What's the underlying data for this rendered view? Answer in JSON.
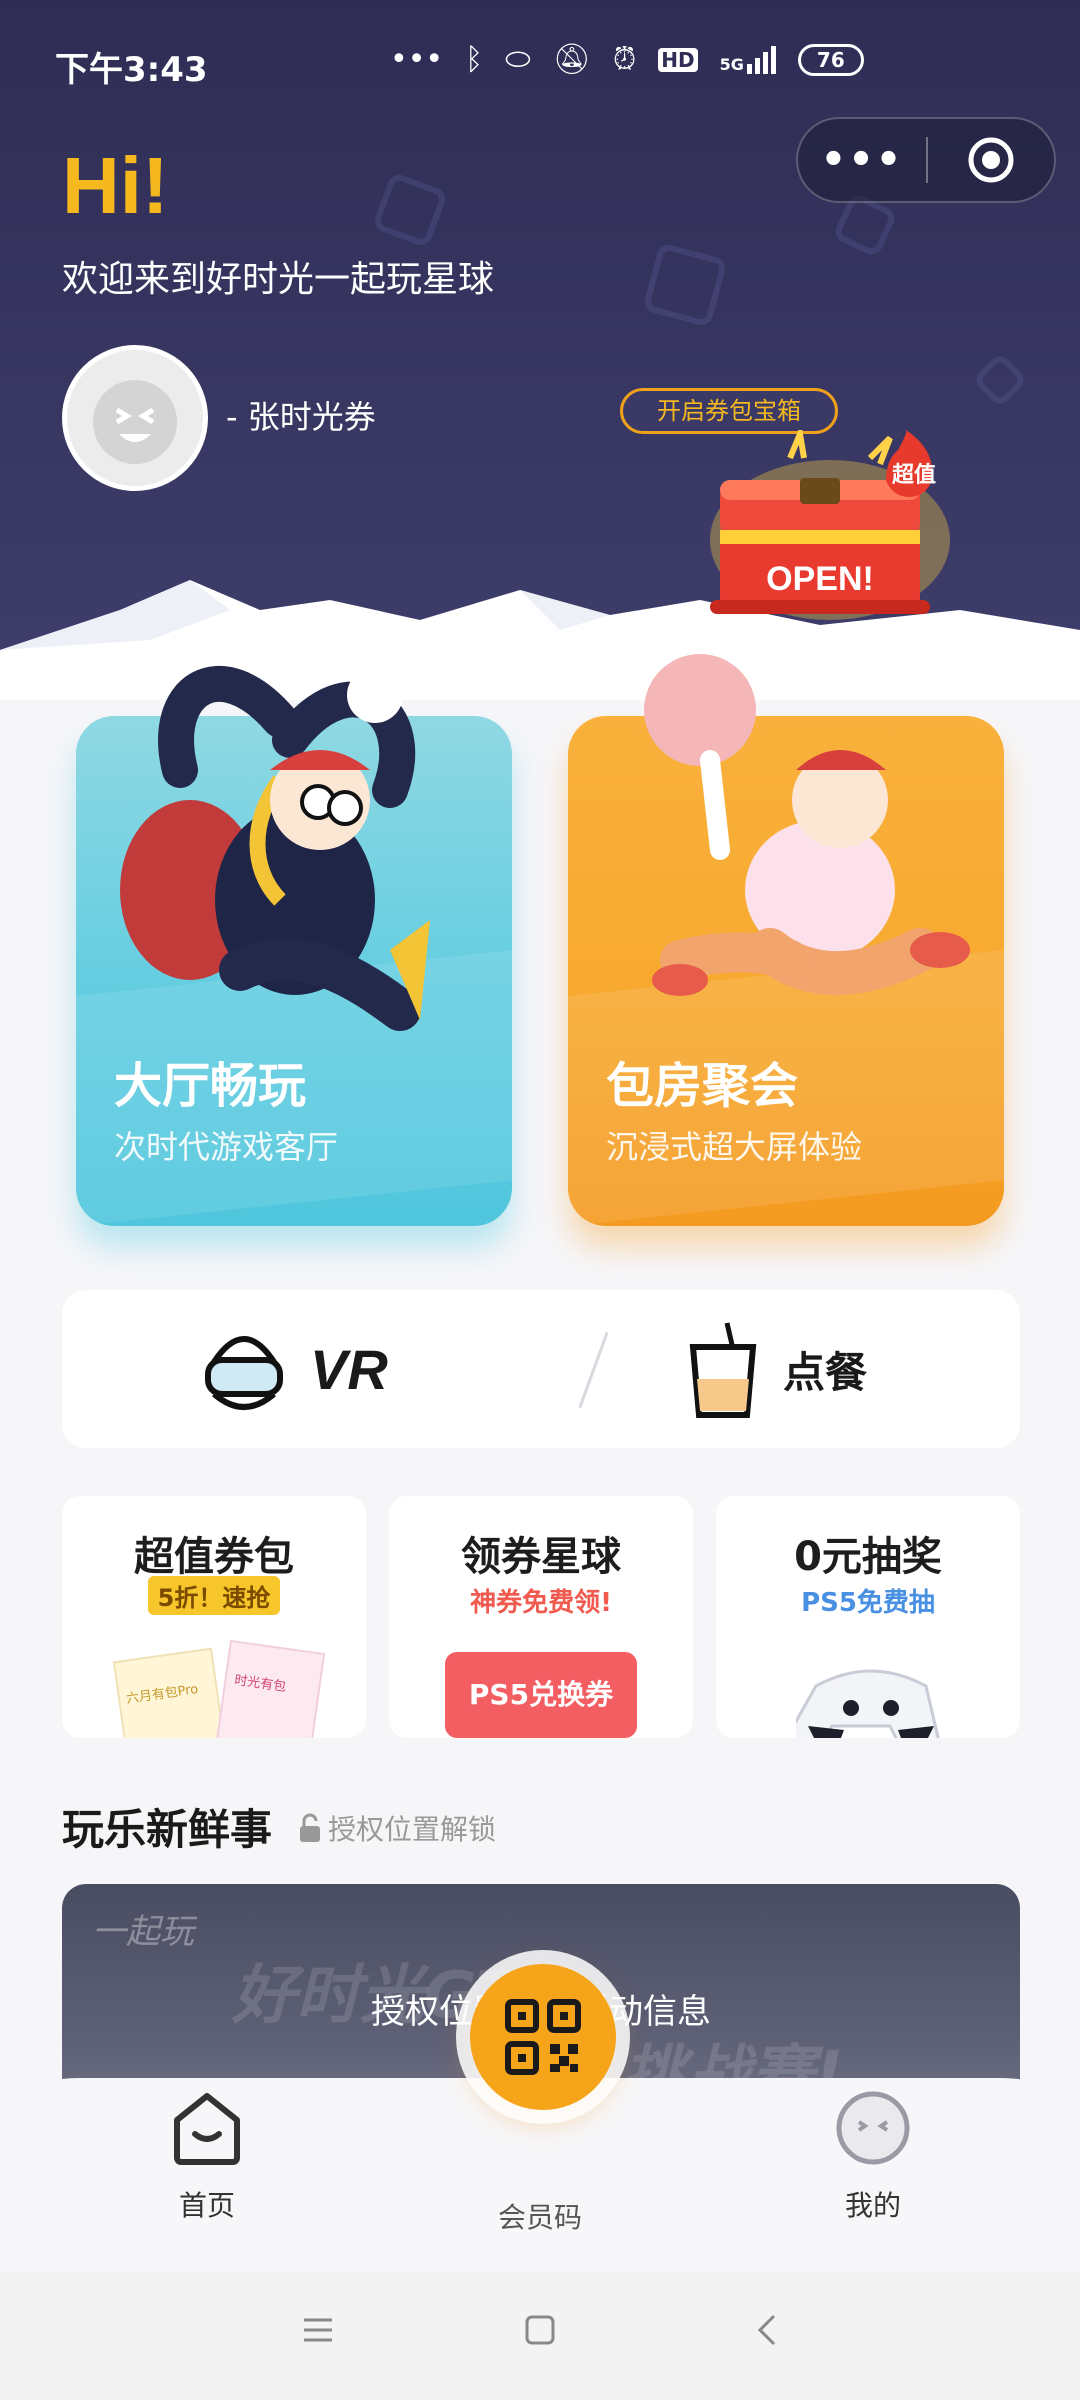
{
  "status_bar": {
    "time": "下午3:43",
    "icons": [
      "more-dots-icon",
      "bluetooth-icon",
      "nfc-icon",
      "mute-icon",
      "alarm-icon",
      "hd-icon",
      "5g-signal-icon",
      "battery-icon"
    ],
    "hd": "HD",
    "network": "5G",
    "battery": "76"
  },
  "capsule": {
    "more_icon": "more-icon",
    "close_icon": "target-icon"
  },
  "header": {
    "greeting": "Hi!",
    "welcome": "欢迎来到好时光一起玩星球",
    "username": "- 张时光券",
    "chest_tag": "开启券包宝箱",
    "chest_badge": "超值",
    "chest_open": "OPEN!"
  },
  "feature_cards": [
    {
      "title": "大厅畅玩",
      "subtitle": "次时代游戏客厅"
    },
    {
      "title": "包房聚会",
      "subtitle": "沉浸式超大屏体验"
    }
  ],
  "quick_links": {
    "vr": "VR",
    "order": "点餐"
  },
  "promo_cards": [
    {
      "title": "超值券包",
      "tag": "5折！速抢",
      "card_a": "六月有包Pro",
      "card_b": "时光有包"
    },
    {
      "title": "领券星球",
      "subtitle": "神券免费领!",
      "coupon": "PS5兑换券"
    },
    {
      "title": "0元抽奖",
      "subtitle": "PS5免费抽"
    }
  ],
  "news": {
    "title": "玩乐新鲜事",
    "lock_hint": "授权位置解锁",
    "banner_message": "授权位置解锁活动信息",
    "banner_ghost_1": "好时光GT",
    "banner_ghost_2": "挑战赛!",
    "banner_logo": "一起玩"
  },
  "tabbar": {
    "home": "首页",
    "member_code": "会员码",
    "mine": "我的"
  },
  "colors": {
    "header_bg": "#2f2d55",
    "accent_yellow": "#f5b81e",
    "card_blue": "#62cde0",
    "card_orange": "#f8a92f",
    "coupon_red": "#f35e63",
    "ps5_blue": "#4a90e2"
  }
}
